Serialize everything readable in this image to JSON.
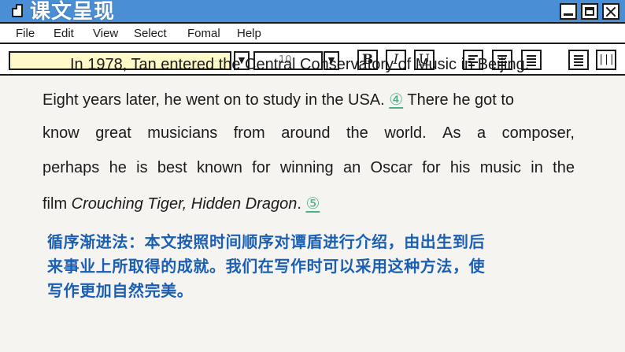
{
  "window": {
    "title": "课文呈现"
  },
  "menu": {
    "items": [
      "File",
      "Edit",
      "View",
      "Select",
      "Fomal",
      "Help"
    ]
  },
  "toolbar": {
    "font_size_placeholder": "10",
    "bold_label": "B",
    "italic_label": "I",
    "underline_label": "U"
  },
  "text": {
    "line1": "In 1978, Tan entered the Central Conservatory of Music in Beijing.",
    "line2_a": "Eight years later, he went on to study in the USA.",
    "marker4": "④",
    "line2_b": "There he got to",
    "line3_words": [
      "know",
      "great",
      "musicians",
      "from",
      "around",
      "the",
      "world.",
      "As",
      "a",
      "composer,"
    ],
    "line4_words": [
      "perhaps",
      "he",
      "is",
      "best",
      "known",
      "for",
      "winning",
      "an",
      "Oscar",
      "for",
      "his",
      "music",
      "in",
      "the"
    ],
    "line5_a": "film",
    "film_title": "Crouching Tiger, Hidden Dragon",
    "line5_period": ".",
    "marker5": "⑤"
  },
  "note": {
    "line1": "循序渐进法：本文按照时间顺序对谭盾进行介绍，由出生到后",
    "line2": "来事业上所取得的成就。我们在写作时可以采用这种方法，使",
    "line3": "写作更加自然完美。"
  },
  "colors": {
    "title_bar": "#4a8fd6",
    "marker": "#4cb08a",
    "note_text": "#1a5fb4",
    "font_box": "#fff8c8"
  }
}
